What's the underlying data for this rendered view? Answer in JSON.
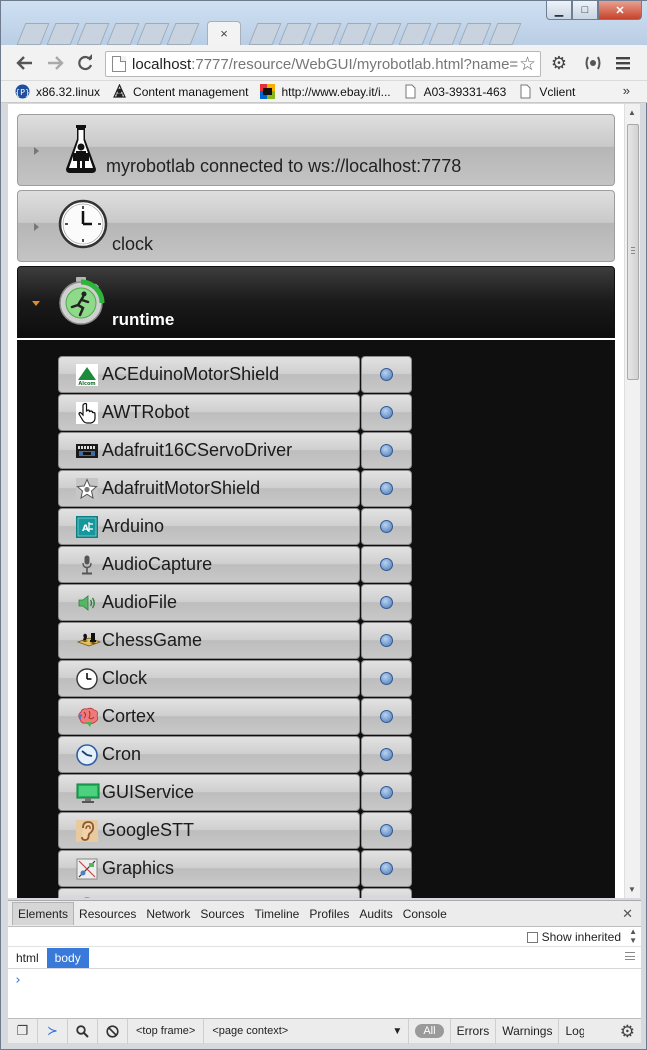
{
  "window": {
    "controls": {
      "minimize": "▁",
      "maximize": "□",
      "close": "✕"
    },
    "tab_close": "×"
  },
  "toolbar": {
    "url_host": "localhost",
    "url_rest": ":7777/resource/WebGUI/myrobotlab.html?name="
  },
  "bookmarks": [
    {
      "label": "x86.32.linux",
      "icon": "pi-icon"
    },
    {
      "label": "Content management",
      "icon": "user-icon"
    },
    {
      "label": "http://www.ebay.it/i...",
      "icon": "ebay-icon"
    },
    {
      "label": "A03-39331-463",
      "icon": "page-icon"
    },
    {
      "label": "Vclient",
      "icon": "page-icon"
    }
  ],
  "bookmarks_overflow": "»",
  "panels": {
    "connection": {
      "title": "myrobotlab connected to ws://localhost:7778",
      "icon": "flask-robot-icon"
    },
    "clock": {
      "title": "clock",
      "icon": "clock-icon"
    },
    "runtime": {
      "title": "runtime",
      "icon": "runtime-icon"
    }
  },
  "services": [
    {
      "label": "ACEduinoMotorShield",
      "icon": "aceduino-icon"
    },
    {
      "label": "AWTRobot",
      "icon": "hand-pointer-icon"
    },
    {
      "label": "Adafruit16CServoDriver",
      "icon": "servo-board-icon"
    },
    {
      "label": "AdafruitMotorShield",
      "icon": "star-shield-icon"
    },
    {
      "label": "Arduino",
      "icon": "arduino-icon"
    },
    {
      "label": "AudioCapture",
      "icon": "microphone-icon"
    },
    {
      "label": "AudioFile",
      "icon": "speaker-icon"
    },
    {
      "label": "ChessGame",
      "icon": "chess-icon"
    },
    {
      "label": "Clock",
      "icon": "clock-icon"
    },
    {
      "label": "Cortex",
      "icon": "brain-icon"
    },
    {
      "label": "Cron",
      "icon": "cron-clock-icon"
    },
    {
      "label": "GUIService",
      "icon": "monitor-icon"
    },
    {
      "label": "GoogleSTT",
      "icon": "ear-icon"
    },
    {
      "label": "Graphics",
      "icon": "graphics-icon"
    },
    {
      "label": "",
      "icon": "globe-icon"
    }
  ],
  "devtools": {
    "tabs": [
      "Elements",
      "Resources",
      "Network",
      "Sources",
      "Timeline",
      "Profiles",
      "Audits",
      "Console"
    ],
    "selected_tab": "Elements",
    "show_inherited": "Show inherited",
    "breadcrumbs": [
      "html",
      "body"
    ],
    "selected_crumb": "body",
    "prompt": "›",
    "frame_select": "<top frame>",
    "context_select": "<page context>",
    "filter_all": "All",
    "levels": [
      "Errors",
      "Warnings",
      "Log"
    ]
  }
}
